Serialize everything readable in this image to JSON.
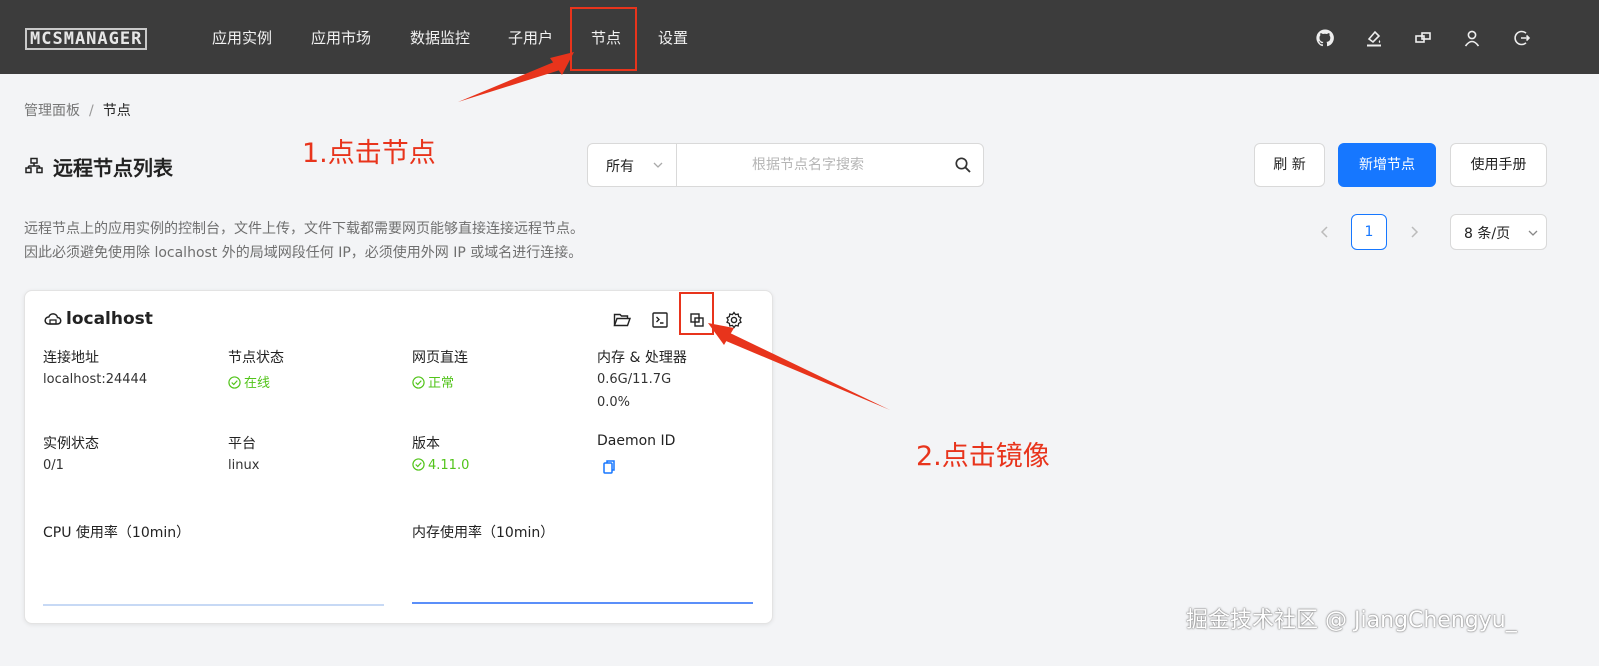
{
  "app": {
    "logo_text": "MCSMANAGER",
    "nav": [
      "应用实例",
      "应用市场",
      "数据监控",
      "子用户",
      "节点",
      "设置"
    ],
    "top_icons": [
      "github-icon",
      "brush-icon",
      "layout-icon",
      "user-icon",
      "logout-icon"
    ]
  },
  "breadcrumb": {
    "root": "管理面板",
    "separator": "/",
    "current": "节点"
  },
  "page": {
    "title": "远程节点列表",
    "filter_value": "所有",
    "search_placeholder": "根据节点名字搜索",
    "refresh_label": "刷 新",
    "add_label": "新增节点",
    "manual_label": "使用手册",
    "description_line1": "远程节点上的应用实例的控制台，文件上传，文件下载都需要网页能够直接连接远程节点。",
    "description_line2": "因此必须避免使用除 localhost 外的局域网段任何 IP，必须使用外网 IP 或域名进行连接。",
    "current_page": "1",
    "page_size": "8 条/页"
  },
  "node": {
    "name": "localhost",
    "address_label": "连接地址",
    "address": "localhost:24444",
    "status_label": "节点状态",
    "status": "在线",
    "web_label": "网页直连",
    "web": "正常",
    "mem_label": "内存 & 处理器",
    "mem": "0.6G/11.7G",
    "cpu": "0.0%",
    "instances_label": "实例状态",
    "instances": "0/1",
    "platform_label": "平台",
    "platform": "linux",
    "version_label": "版本",
    "version": "4.11.0",
    "daemon_label": "Daemon ID",
    "cpu_chart_label": "CPU 使用率（10min）",
    "mem_chart_label": "内存使用率（10min）"
  },
  "annotations": {
    "step1": "1.点击节点",
    "step2": "2.点击镜像"
  },
  "watermark": "掘金技术社区 @ JiangChengyu_",
  "colors": {
    "topbar": "#3c3c3c",
    "primary": "#1677ff",
    "success": "#52c41a",
    "annotation": "#e8341c"
  }
}
